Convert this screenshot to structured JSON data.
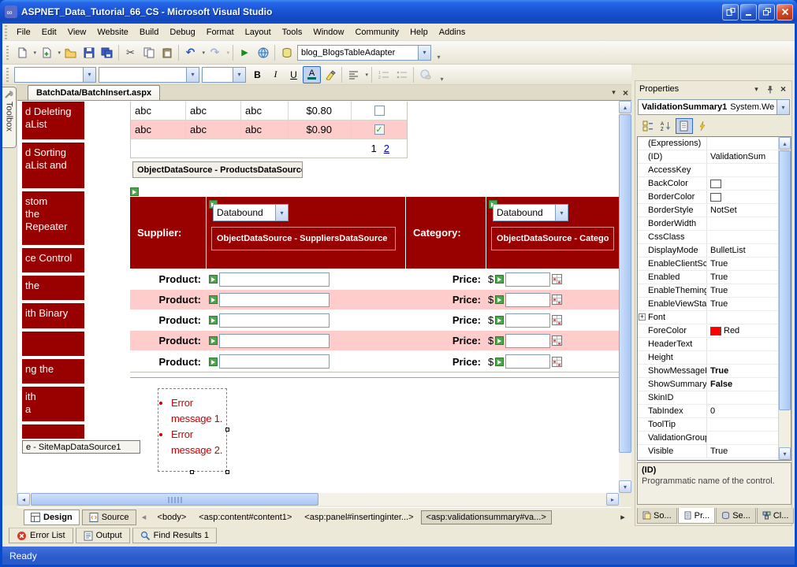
{
  "window": {
    "title": "ASPNET_Data_Tutorial_66_CS - Microsoft Visual Studio"
  },
  "menu": {
    "items": [
      {
        "label": "File"
      },
      {
        "label": "Edit"
      },
      {
        "label": "View"
      },
      {
        "label": "Website"
      },
      {
        "label": "Build"
      },
      {
        "label": "Debug"
      },
      {
        "label": "Format"
      },
      {
        "label": "Layout"
      },
      {
        "label": "Tools"
      },
      {
        "label": "Window"
      },
      {
        "label": "Community"
      },
      {
        "label": "Help"
      },
      {
        "label": "Addins"
      }
    ]
  },
  "toolbar": {
    "adapter_combo": "blog_BlogsTableAdapter"
  },
  "format_toolbar": {
    "bold": "B",
    "italic": "I",
    "underline": "U",
    "font_color": "A"
  },
  "toolbox": {
    "label": "Toolbox"
  },
  "document": {
    "tab_label": "BatchData/BatchInsert.aspx"
  },
  "sidebar": {
    "blocks": [
      {
        "text": "d Deleting\naList"
      },
      {
        "text": "d Sorting\naList and"
      },
      {
        "text": "stom\nthe\nRepeater"
      },
      {
        "text": "ce Control"
      },
      {
        "text": "the"
      },
      {
        "text": "ith Binary"
      },
      {
        "text": ""
      },
      {
        "text": "ng the"
      },
      {
        "text": "ith\na"
      },
      {
        "text": ""
      }
    ],
    "sitemap_label": "e - SiteMapDataSource1"
  },
  "gridview": {
    "rows": [
      {
        "c1": "abc",
        "c2": "abc",
        "c3": "abc",
        "price": "$0.80",
        "checked": false
      },
      {
        "c1": "abc",
        "c2": "abc",
        "c3": "abc",
        "price": "$0.90",
        "checked": true
      }
    ],
    "pager_current": "1",
    "pager_link": "2",
    "datasource_label": "ObjectDataSource - ProductsDataSource"
  },
  "insert_panel": {
    "supplier_label": "Supplier:",
    "supplier_dropdown": "Databound",
    "supplier_datasource": "ObjectDataSource - SuppliersDataSource",
    "category_label": "Category:",
    "category_dropdown": "Databound",
    "category_datasource": "ObjectDataSource - Catego",
    "rows": [
      {
        "product_label": "Product:",
        "price_label": "Price:",
        "currency": "$"
      },
      {
        "product_label": "Product:",
        "price_label": "Price:",
        "currency": "$"
      },
      {
        "product_label": "Product:",
        "price_label": "Price:",
        "currency": "$"
      },
      {
        "product_label": "Product:",
        "price_label": "Price:",
        "currency": "$"
      },
      {
        "product_label": "Product:",
        "price_label": "Price:",
        "currency": "$"
      }
    ],
    "errors": [
      {
        "text": "Error message 1."
      },
      {
        "text": "Error message 2."
      }
    ]
  },
  "view_bar": {
    "design_tab": "Design",
    "source_tab": "Source",
    "tags": [
      {
        "label": "<body>",
        "selected": false
      },
      {
        "label": "<asp:content#content1>",
        "selected": false
      },
      {
        "label": "<asp:panel#insertinginter...>",
        "selected": false
      },
      {
        "label": "<asp:validationsummary#va...>",
        "selected": true
      }
    ]
  },
  "properties": {
    "title": "Properties",
    "object_name": "ValidationSummary1",
    "object_type": "System.We",
    "rows": [
      {
        "name": "(Expressions)",
        "value": ""
      },
      {
        "name": "(ID)",
        "value": "ValidationSum"
      },
      {
        "name": "AccessKey",
        "value": ""
      },
      {
        "name": "BackColor",
        "value": "",
        "swatch": "#FFFFFF"
      },
      {
        "name": "BorderColor",
        "value": "",
        "swatch": "#FFFFFF"
      },
      {
        "name": "BorderStyle",
        "value": "NotSet"
      },
      {
        "name": "BorderWidth",
        "value": ""
      },
      {
        "name": "CssClass",
        "value": ""
      },
      {
        "name": "DisplayMode",
        "value": "BulletList"
      },
      {
        "name": "EnableClientScri",
        "value": "True"
      },
      {
        "name": "Enabled",
        "value": "True"
      },
      {
        "name": "EnableTheming",
        "value": "True"
      },
      {
        "name": "EnableViewState",
        "value": "True"
      },
      {
        "name": "Font",
        "value": "",
        "expand": true
      },
      {
        "name": "ForeColor",
        "value": "Red",
        "swatch": "#FF0000"
      },
      {
        "name": "HeaderText",
        "value": ""
      },
      {
        "name": "Height",
        "value": ""
      },
      {
        "name": "ShowMessageBo",
        "value": "True",
        "bold": true
      },
      {
        "name": "ShowSummary",
        "value": "False",
        "bold": true
      },
      {
        "name": "SkinID",
        "value": ""
      },
      {
        "name": "TabIndex",
        "value": "0"
      },
      {
        "name": "ToolTip",
        "value": ""
      },
      {
        "name": "ValidationGroup",
        "value": ""
      },
      {
        "name": "Visible",
        "value": "True"
      }
    ],
    "description_title": "(ID)",
    "description_text": "Programmatic name of the control.",
    "tabs": [
      {
        "label": "So..."
      },
      {
        "label": "Pr..."
      },
      {
        "label": "Se..."
      },
      {
        "label": "Cl..."
      }
    ]
  },
  "bottom_tabs": {
    "error_list": "Error List",
    "output": "Output",
    "find_results": "Find Results 1"
  },
  "status": {
    "text": "Ready"
  },
  "colors": {
    "header_red": "#990000",
    "alt_row_pink": "#FFCCCC",
    "error_text": "#CC0000",
    "forecolor_swatch": "#FF0000",
    "titlebar_blue": "#1B55D6"
  }
}
